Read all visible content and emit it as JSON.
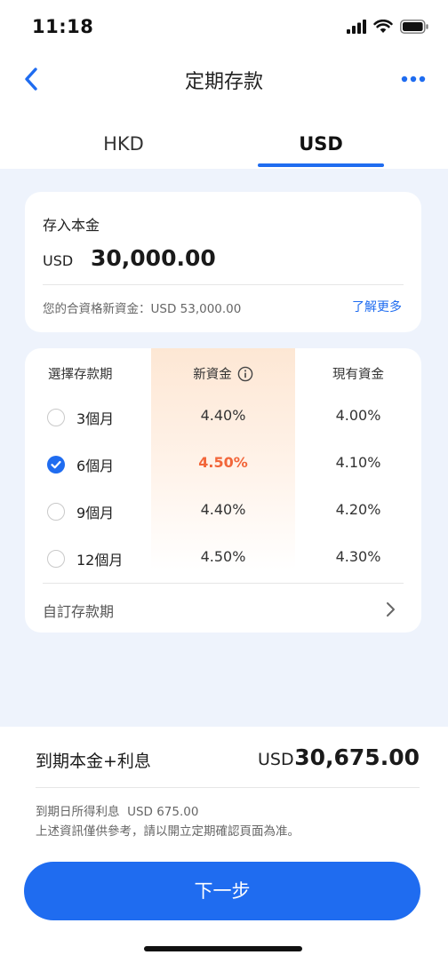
{
  "status_bar": {
    "time": "11:18"
  },
  "nav": {
    "title": "定期存款",
    "back_icon": "chevron-left-icon",
    "more_icon": "more-dots-icon"
  },
  "tabs": [
    {
      "label": "HKD",
      "selected": false
    },
    {
      "label": "USD",
      "selected": true
    }
  ],
  "principal": {
    "label": "存入本金",
    "currency": "USD",
    "amount": "30,000.00",
    "eligible_text": "您的合資格新資金：USD 53,000.00",
    "learn_more": "了解更多"
  },
  "rates": {
    "headers": {
      "term": "選擇存款期",
      "new_funds": "新資金",
      "existing_funds": "現有資金"
    },
    "rows": [
      {
        "term": "3個月",
        "new": "4.40%",
        "existing": "4.00%",
        "selected": false
      },
      {
        "term": "6個月",
        "new": "4.50%",
        "existing": "4.10%",
        "selected": true
      },
      {
        "term": "9個月",
        "new": "4.40%",
        "existing": "4.20%",
        "selected": false
      },
      {
        "term": "12個月",
        "new": "4.50%",
        "existing": "4.30%",
        "selected": false
      }
    ],
    "custom_term": "自訂存款期"
  },
  "summary": {
    "maturity_label": "到期本金+利息",
    "currency": "USD",
    "amount": "30,675.00",
    "interest_line": "到期日所得利息  USD 675.00",
    "disclaimer": "上述資訊僅供參考，請以開立定期確認頁面為准。"
  },
  "next_button": "下一步",
  "colors": {
    "accent": "#1f6cf0",
    "highlight_rate": "#f2663a",
    "background": "#eef3fc"
  }
}
